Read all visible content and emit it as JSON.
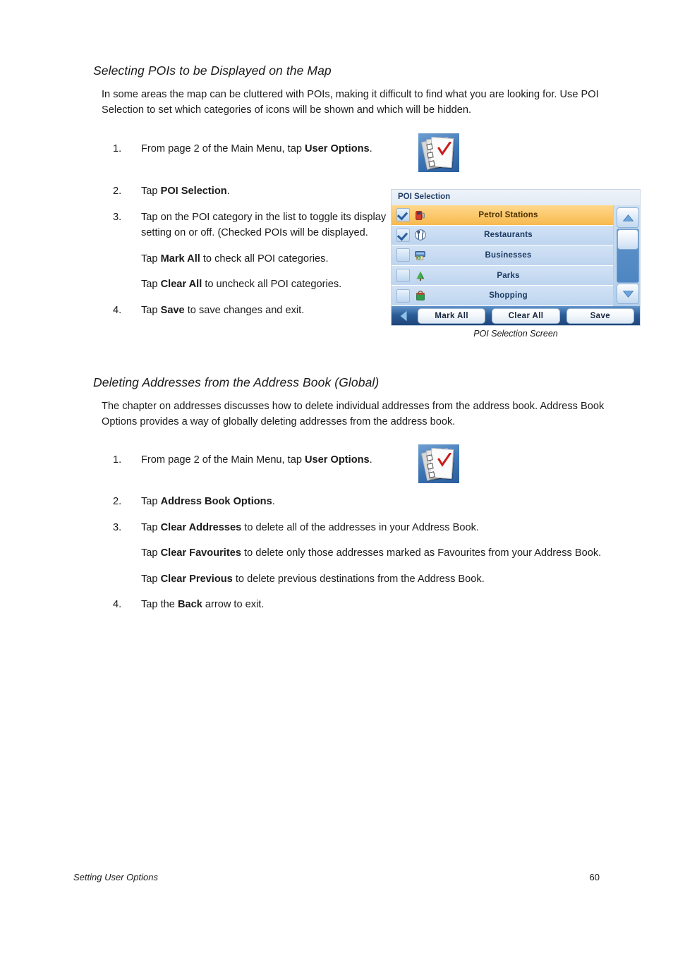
{
  "document": {
    "footer_left": "Setting User Options",
    "page_number": "60"
  },
  "sections": [
    {
      "heading": "Selecting POIs to be Displayed on the Map",
      "intro": "In some areas the map can be cluttered with POIs, making it difficult to find what you are looking for.  Use POI Selection to set which categories of icons will be shown and which will be hidden.",
      "steps": {
        "n1": "1.",
        "s1_pre": "From page 2 of the Main Menu, tap ",
        "s1_bold": "User Options",
        "s1_post": ".",
        "n2": "2.",
        "s2_pre": "Tap ",
        "s2_bold": "POI Selection",
        "s2_post": ".",
        "n3": "3.",
        "s3": "Tap on the POI category in the list to toggle its display setting on or off.  (Checked POIs will be displayed.",
        "s3a_pre": "Tap ",
        "s3a_bold": "Mark All",
        "s3a_post": " to check all POI categories.",
        "s3b_pre": "Tap ",
        "s3b_bold": "Clear All",
        "s3b_post": " to uncheck all POI categories.",
        "n4": "4.",
        "s4_pre": "Tap ",
        "s4_bold": "Save",
        "s4_post": " to save changes and exit."
      }
    },
    {
      "heading": "Deleting Addresses from the Address Book (Global)",
      "intro": "The chapter on addresses discusses how to delete individual addresses from the address book. Address Book Options provides a way of globally deleting addresses from the address book.",
      "steps": {
        "n1": "1.",
        "s1_pre": "From page 2 of the Main Menu, tap ",
        "s1_bold": "User Options",
        "s1_post": ".",
        "n2": "2.",
        "s2_pre": "Tap ",
        "s2_bold": "Address Book Options",
        "s2_post": ".",
        "n3": "3.",
        "s3_pre": "Tap ",
        "s3_bold": "Clear Addresses",
        "s3_post": " to delete all of the addresses in your Address Book.",
        "s3a_pre": "Tap ",
        "s3a_bold": "Clear Favourites",
        "s3a_post": " to delete only those addresses marked as Favourites from your Address Book.",
        "s3b_pre": "Tap ",
        "s3b_bold": "Clear Previous",
        "s3b_post": " to delete previous destinations from the Address Book.",
        "n4": "4.",
        "s4_pre": "Tap the ",
        "s4_bold": "Back",
        "s4_post": " arrow to exit."
      }
    }
  ],
  "poi_screen": {
    "title": "POI Selection",
    "caption": "POI Selection Screen",
    "rows": [
      {
        "label": "Petrol Stations",
        "checked": true,
        "selected": true,
        "icon": "petrol-pump-icon"
      },
      {
        "label": "Restaurants",
        "checked": true,
        "selected": false,
        "icon": "fork-knife-icon"
      },
      {
        "label": "Businesses",
        "checked": false,
        "selected": false,
        "icon": "business-icon"
      },
      {
        "label": "Parks",
        "checked": false,
        "selected": false,
        "icon": "park-tree-icon"
      },
      {
        "label": "Shopping",
        "checked": false,
        "selected": false,
        "icon": "shopping-bag-icon"
      }
    ],
    "buttons": {
      "mark_all": "Mark All",
      "clear_all": "Clear All",
      "save": "Save"
    },
    "colors": {
      "selected_row": "#f7b94e",
      "row": "#c6daf1",
      "row_text": "#1b3a63",
      "bottom_bar": "#2c5c97",
      "scroll_track": "#4e86c2"
    }
  },
  "icons": {
    "user_options": "user-options-checklist-icon",
    "back_arrow": "back-arrow-icon",
    "scroll_up": "scroll-up-arrow-icon",
    "scroll_down": "scroll-down-arrow-icon"
  }
}
